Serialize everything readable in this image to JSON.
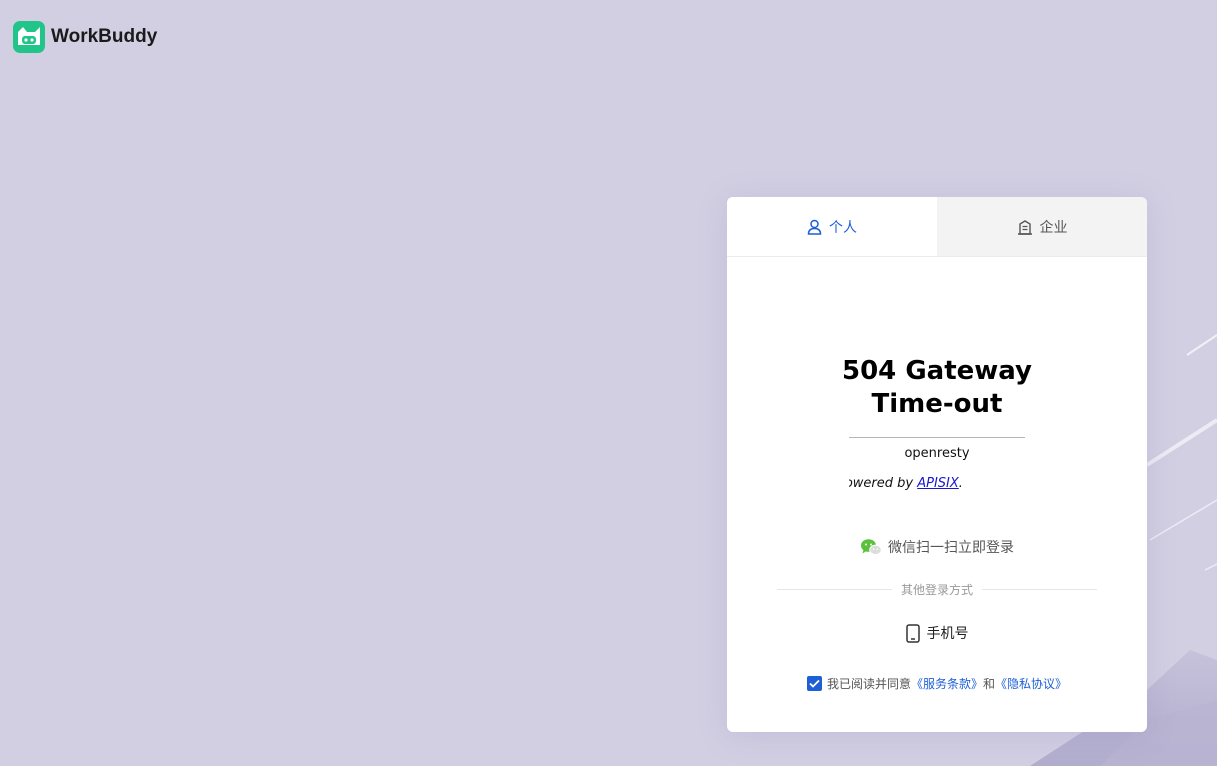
{
  "brand": {
    "name": "WorkBuddy"
  },
  "tabs": {
    "personal": "个人",
    "enterprise": "企业",
    "active": "personal"
  },
  "error_page": {
    "title_line1": "504 Gateway",
    "title_line2": "Time-out",
    "server": "openresty",
    "powered_prefix": "Powered by ",
    "powered_link": "APISIX",
    "powered_suffix": "."
  },
  "login": {
    "wechat_text": "微信扫一扫立即登录",
    "other_methods": "其他登录方式",
    "phone_label": "手机号"
  },
  "agreement": {
    "checked": true,
    "prefix": "我已阅读并同意",
    "terms": "《服务条款》",
    "and": "和",
    "privacy": "《隐私协议》"
  },
  "colors": {
    "background": "#d2cfe3",
    "accent": "#1f5fd6",
    "brand_green": "#21c589",
    "wechat_green": "#5bc03b"
  }
}
